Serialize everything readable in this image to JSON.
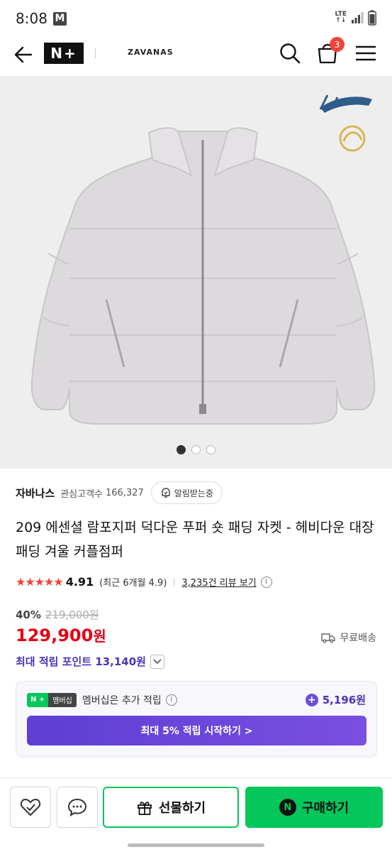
{
  "status": {
    "time": "8:08",
    "notif_badge": "M",
    "network": "LTE"
  },
  "header": {
    "logo": "N+",
    "store": "ZAVANAS",
    "cart_count": "3"
  },
  "carousel": {
    "pages": 3,
    "active": 0
  },
  "shop": {
    "name": "자바나스",
    "follower_label": "관심고객수",
    "follower_count": "166,327",
    "alarm_label": "알림받는중"
  },
  "product": {
    "title": "209 에센셜 람포지퍼 덕다운 푸퍼 숏 패딩 자켓 - 헤비다운 대장패딩 겨울 커플점퍼",
    "stars": "★★★★★",
    "rating": "4.91",
    "recent": "(최근 6개월 4.9)",
    "review_link": "3,235건 리뷰 보기",
    "discount": "40%",
    "original_price": "219,000원",
    "price": "129,900",
    "price_unit": "원",
    "shipping": "무료배송",
    "points": "최대 적립 포인트 13,140원"
  },
  "membership": {
    "badge_n": "N +",
    "badge_label": "멤버십",
    "text": "멤버십은 추가 적립",
    "amount": "5,196원",
    "cta": "최대 5% 적립 시작하기 >"
  },
  "bottom": {
    "gift": "선물하기",
    "buy": "구매하기",
    "buy_icon": "N"
  },
  "colors": {
    "accent_green": "#03c75a",
    "price_red": "#e60013",
    "point_purple": "#4a35b5"
  }
}
